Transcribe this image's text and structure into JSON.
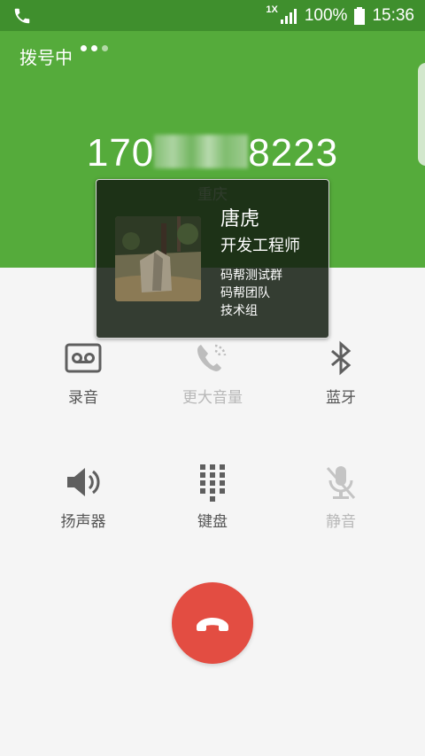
{
  "status_bar": {
    "network": "1X",
    "battery": "100%",
    "time": "15:36"
  },
  "call": {
    "status": "拨号中",
    "number_prefix": "170",
    "number_suffix": "8223",
    "location": "重庆"
  },
  "contact": {
    "name": "唐虎",
    "title": "开发工程师",
    "groups": [
      "码帮测试群",
      "码帮团队",
      "技术组"
    ]
  },
  "controls": [
    {
      "label": "录音",
      "icon": "cassette-icon",
      "enabled": true
    },
    {
      "label": "更大音量",
      "icon": "volume-boost-icon",
      "enabled": false
    },
    {
      "label": "蓝牙",
      "icon": "bluetooth-icon",
      "enabled": true
    },
    {
      "label": "扬声器",
      "icon": "speaker-icon",
      "enabled": true
    },
    {
      "label": "键盘",
      "icon": "keypad-icon",
      "enabled": true
    },
    {
      "label": "静音",
      "icon": "mute-icon",
      "enabled": false
    }
  ],
  "colors": {
    "header": "#55ab3b",
    "status_bar": "#3f8f2d",
    "end_call": "#e34d42"
  }
}
